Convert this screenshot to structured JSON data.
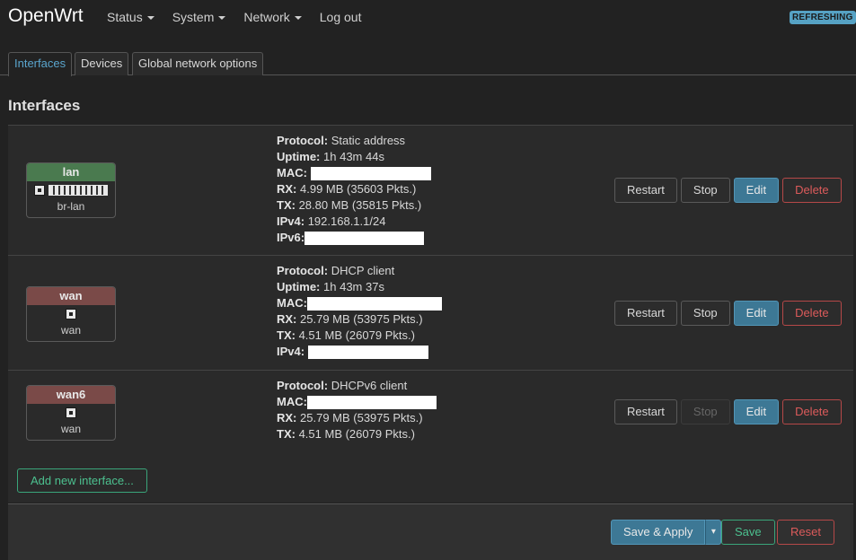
{
  "brand": "OpenWrt",
  "nav": {
    "status": "Status",
    "system": "System",
    "network": "Network",
    "logout": "Log out"
  },
  "refresh_badge": "REFRESHING",
  "tabs": {
    "interfaces": "Interfaces",
    "devices": "Devices",
    "global": "Global network options"
  },
  "section_title": "Interfaces",
  "labels": {
    "protocol": "Protocol:",
    "uptime": "Uptime:",
    "mac": "MAC:",
    "rx": "RX:",
    "tx": "TX:",
    "ipv4": "IPv4:",
    "ipv6": "IPv6:"
  },
  "buttons": {
    "restart": "Restart",
    "stop": "Stop",
    "edit": "Edit",
    "delete": "Delete"
  },
  "interfaces": [
    {
      "name": "lan",
      "device": "br-lan",
      "protocol": "Static address",
      "uptime": "1h 43m 44s",
      "rx": "4.99 MB (35603 Pkts.)",
      "tx": "28.80 MB (35815 Pkts.)",
      "ipv4": "192.168.1.1/24"
    },
    {
      "name": "wan",
      "device": "wan",
      "protocol": "DHCP client",
      "uptime": "1h 43m 37s",
      "rx": "25.79 MB (53975 Pkts.)",
      "tx": "4.51 MB (26079 Pkts.)"
    },
    {
      "name": "wan6",
      "device": "wan",
      "protocol": "DHCPv6 client",
      "rx": "25.79 MB (53975 Pkts.)",
      "tx": "4.51 MB (26079 Pkts.)"
    }
  ],
  "add_interface": "Add new interface...",
  "footer": {
    "save_apply": "Save & Apply",
    "dropdown": "▾",
    "save": "Save",
    "reset": "Reset"
  },
  "colors": {
    "accent": "#56a2c4",
    "edit": "#3d7895",
    "positive": "#4cc08f",
    "negative": "#dc5b5b",
    "lan_badge": "#4a7a4f",
    "wan_badge": "#7a4a48"
  },
  "icons": [
    "caret-down-icon",
    "ethernet-port-icon",
    "bridge-icon"
  ]
}
